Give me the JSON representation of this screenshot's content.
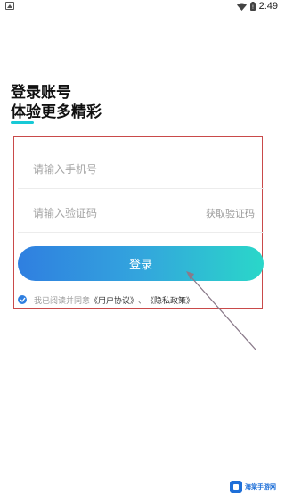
{
  "status_bar": {
    "time": "2:49",
    "icons": [
      "app-notification-icon",
      "wifi-icon",
      "battery-icon"
    ]
  },
  "header": {
    "title": "登录账号",
    "subtitle": "体验更多精彩"
  },
  "form": {
    "phone_placeholder": "请输入手机号",
    "code_placeholder": "请输入验证码",
    "get_code_label": "获取验证码",
    "login_label": "登录"
  },
  "agreement": {
    "checked": true,
    "prefix": "我已阅读并同意",
    "user_agreement": "《用户协议》",
    "separator": "、",
    "privacy_policy": "《隐私政策》"
  },
  "watermark": {
    "text": "海棠手游网"
  },
  "colors": {
    "accent": "#2f7fe0",
    "gradient_end": "#2ad7c9",
    "annotation": "#c94a4a"
  }
}
